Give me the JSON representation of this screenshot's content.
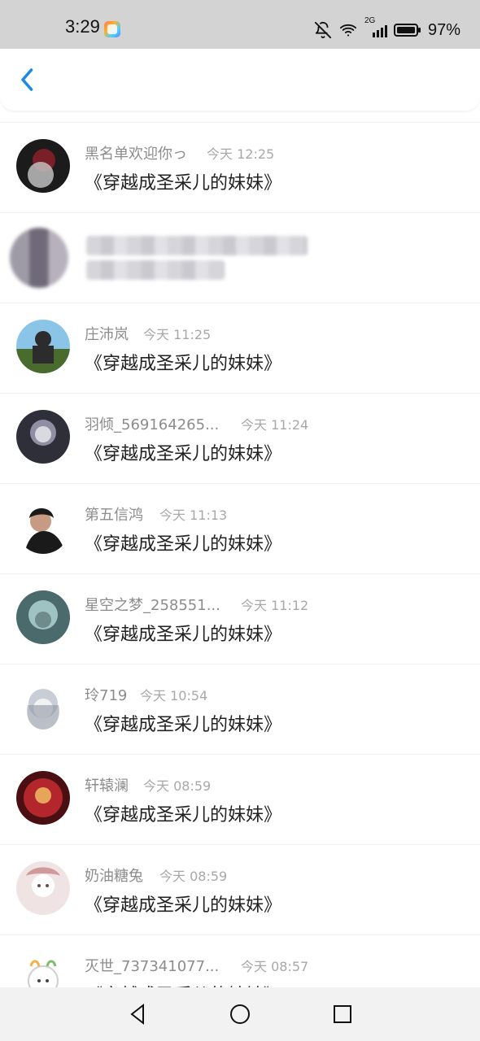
{
  "status_bar": {
    "time": "3:29",
    "battery_text": "97%",
    "icons": [
      "app-badge-icon",
      "bell-mute-icon",
      "wifi-icon",
      "signal-2g-icon",
      "battery-icon"
    ],
    "network_label": "2G"
  },
  "header": {
    "back_icon": "chevron-left-icon",
    "accent_color": "#1e88e5"
  },
  "messages": [
    {
      "name": "黑名单欢迎你っ",
      "time": "今天 12:25",
      "text": "《穿越成圣采儿的妹妹》",
      "avatar_colors": [
        "#1b1b1b",
        "#7a1f27",
        "#c8c8c8"
      ]
    },
    {
      "name": "",
      "time": "",
      "text": "",
      "avatar_colors": [
        "#9e9aa6",
        "#6f6a79",
        "#b6b1bc"
      ],
      "blurred": true
    },
    {
      "name": "庄沛岚",
      "time": "今天 11:25",
      "text": "《穿越成圣采儿的妹妹》",
      "avatar_colors": [
        "#4a6b2e",
        "#8ac5e8",
        "#2c2c2c"
      ]
    },
    {
      "name": "羽倾_569164265...",
      "time": "今天 11:24",
      "text": "《穿越成圣采儿的妹妹》",
      "avatar_colors": [
        "#2f2f3a",
        "#8f8fa3",
        "#d9d9e0"
      ]
    },
    {
      "name": "第五信鸿",
      "time": "今天 11:13",
      "text": "《穿越成圣采儿的妹妹》",
      "avatar_colors": [
        "#1a1a1a",
        "#c79a83",
        "#ffffff"
      ]
    },
    {
      "name": "星空之梦_258551...",
      "time": "今天 11:12",
      "text": "《穿越成圣采儿的妹妹》",
      "avatar_colors": [
        "#4b6a6b",
        "#9fc2c3",
        "#6f8b8c"
      ]
    },
    {
      "name": "玲719",
      "time": "今天 10:54",
      "text": "《穿越成圣采儿的妹妹》",
      "avatar_colors": [
        "#c9ced6",
        "#f2f2f2",
        "#8e96a3"
      ]
    },
    {
      "name": "轩辕澜",
      "time": "今天 08:59",
      "text": "《穿越成圣采儿的妹妹》",
      "avatar_colors": [
        "#4a0f12",
        "#b3262c",
        "#e6a55a"
      ]
    },
    {
      "name": "奶油糖兔",
      "time": "今天 08:59",
      "text": "《穿越成圣采儿的妹妹》",
      "avatar_colors": [
        "#efe3e3",
        "#c47a7a",
        "#6b4b4b"
      ]
    },
    {
      "name": "灭世_737341077...",
      "time": "今天 08:57",
      "text": "《穿越成圣采儿的妹妹》",
      "avatar_colors": [
        "#ffffff",
        "#f4b04a",
        "#7bbf6b"
      ]
    }
  ],
  "nav_bar": {
    "icons": [
      "back-triangle-icon",
      "home-circle-icon",
      "recent-square-icon"
    ]
  }
}
